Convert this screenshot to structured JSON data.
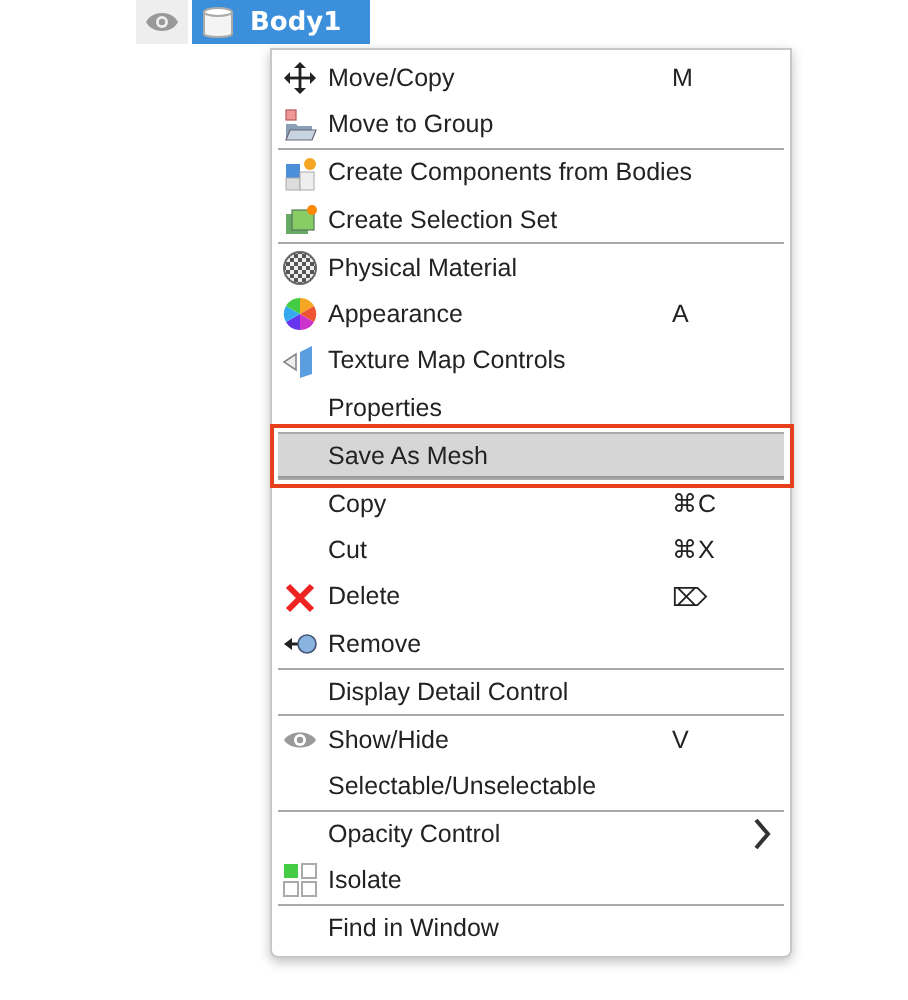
{
  "tree_row": {
    "label": "Body1",
    "selected": true,
    "visible": true
  },
  "menu": {
    "items": [
      {
        "label": "Move/Copy",
        "shortcut": "M",
        "separator_above": false,
        "selected": false
      },
      {
        "label": "Move to Group",
        "separator_above": false,
        "selected": false
      },
      {
        "label": "Create Components from Bodies",
        "separator_above": true,
        "selected": false
      },
      {
        "label": "Create Selection Set",
        "separator_above": false,
        "selected": false
      },
      {
        "label": "Physical Material",
        "separator_above": true,
        "selected": false
      },
      {
        "label": "Appearance",
        "shortcut": "A",
        "separator_above": false,
        "selected": false
      },
      {
        "label": "Texture Map Controls",
        "separator_above": false,
        "selected": false
      },
      {
        "label": "Properties",
        "separator_above": false,
        "selected": false
      },
      {
        "label": "Save As Mesh",
        "separator_above": true,
        "selected": true,
        "outlined": true
      },
      {
        "label": "Copy",
        "shortcut": "⌘C",
        "separator_above": true,
        "selected": false
      },
      {
        "label": "Cut",
        "shortcut": "⌘X",
        "separator_above": false,
        "selected": false
      },
      {
        "label": "Delete",
        "shortcut": "⌦",
        "separator_above": false,
        "selected": false
      },
      {
        "label": "Remove",
        "separator_above": false,
        "selected": false
      },
      {
        "label": "Display Detail Control",
        "separator_above": true,
        "selected": false
      },
      {
        "label": "Show/Hide",
        "shortcut": "V",
        "separator_above": true,
        "selected": false
      },
      {
        "label": "Selectable/Unselectable",
        "separator_above": false,
        "selected": false
      },
      {
        "label": "Opacity Control",
        "submenu": true,
        "separator_above": true,
        "selected": false
      },
      {
        "label": "Isolate",
        "separator_above": false,
        "selected": false
      },
      {
        "label": "Find in Window",
        "separator_above": true,
        "selected": false
      }
    ]
  }
}
